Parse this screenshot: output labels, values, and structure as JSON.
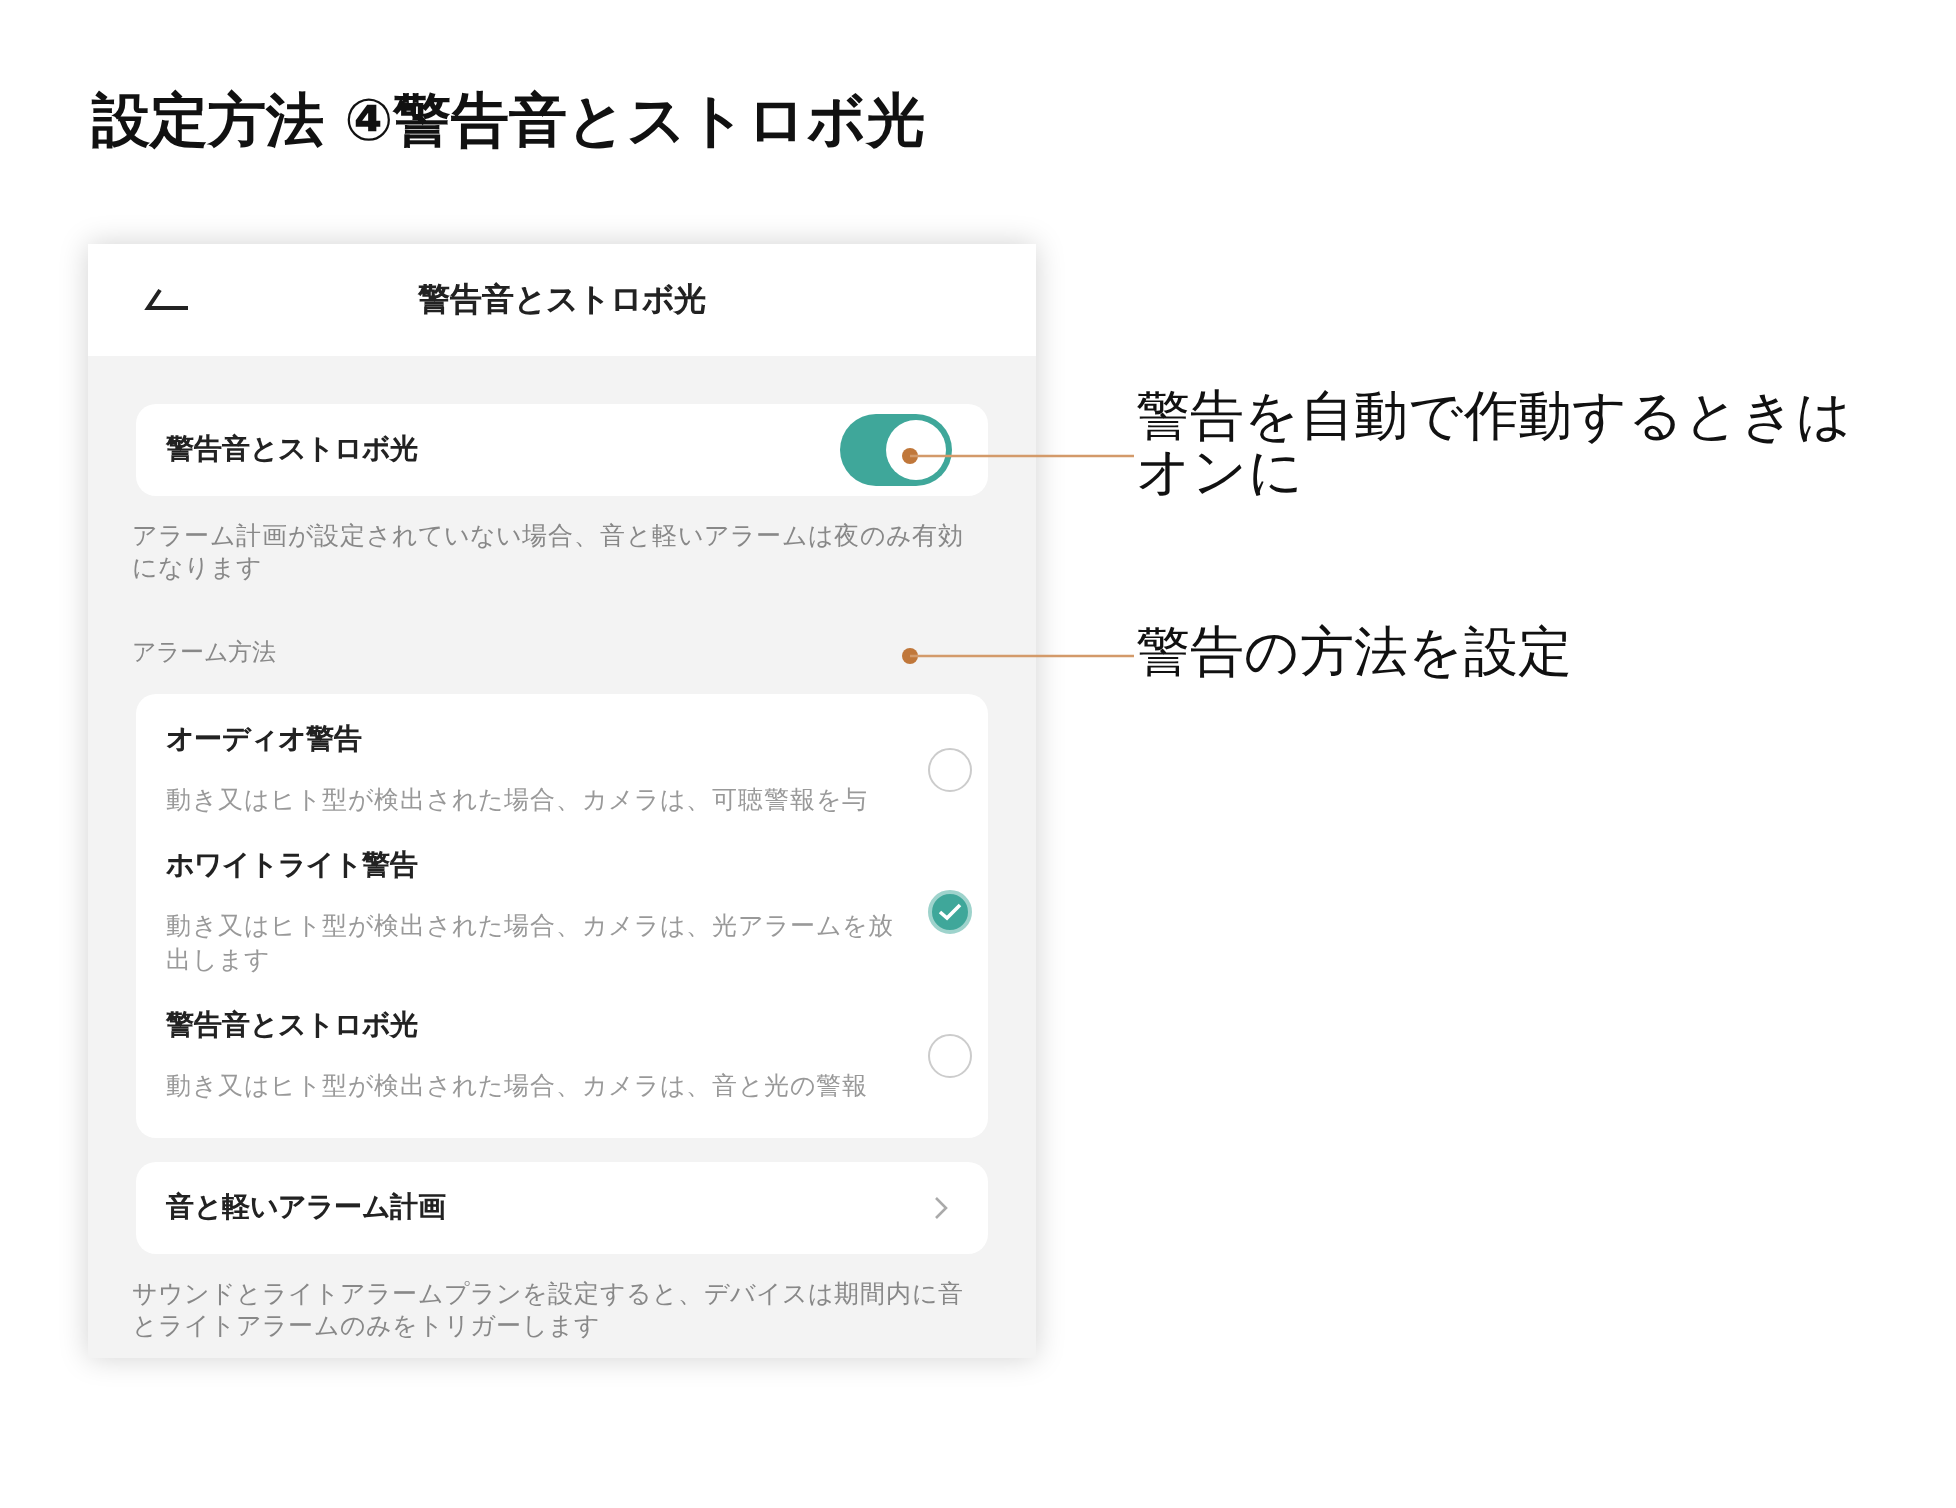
{
  "heading": "設定方法 ④警告音とストロボ光",
  "screen": {
    "title": "警告音とストロボ光",
    "toggle": {
      "label": "警告音とストロボ光",
      "on": true
    },
    "toggle_note": "アラーム計画が設定されていない場合、音と軽いアラームは夜のみ有効になります",
    "section_label": "アラーム方法",
    "methods": [
      {
        "title": "オーディオ警告",
        "description": "動き又はヒト型が検出された場合、カメラは、可聴警報を与",
        "selected": false
      },
      {
        "title": "ホワイトライト警告",
        "description": "動き又はヒト型が検出された場合、カメラは、光アラームを放出します",
        "selected": true
      },
      {
        "title": "警告音とストロボ光",
        "description": "動き又はヒト型が検出された場合、カメラは、音と光の警報",
        "selected": false
      }
    ],
    "plan": {
      "label": "音と軽いアラーム計画"
    },
    "plan_note": "サウンドとライトアラームプランを設定すると、デバイスは期間内に音とライトアラームのみをトリガーします"
  },
  "annotations": [
    {
      "text": "警告を自動で作動するときはオンに"
    },
    {
      "text": "警告の方法を設定"
    }
  ]
}
